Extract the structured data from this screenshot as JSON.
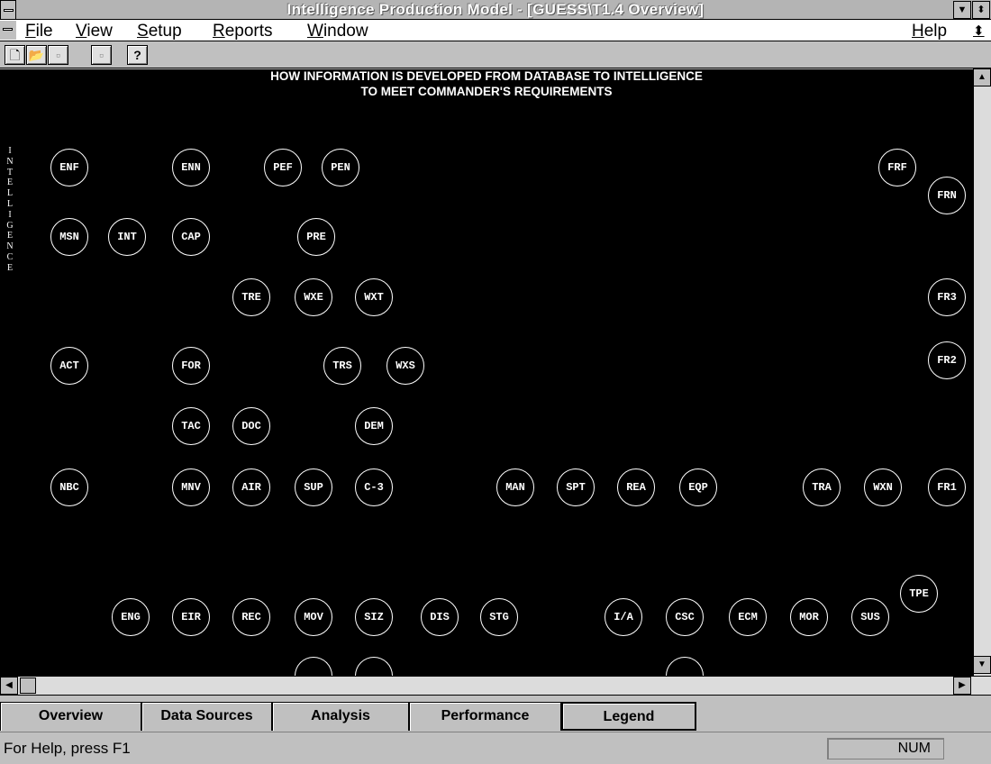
{
  "window": {
    "title": "Intelligence Production Model - [GUESS\\T1.4 Overview]",
    "minimize_glyph": "▼",
    "restore_glyph": "⬍"
  },
  "menu": {
    "items": [
      "File",
      "View",
      "Setup",
      "Reports",
      "Window"
    ],
    "help": "Help",
    "restore_glyph": "⬍"
  },
  "toolbar": {
    "buttons": [
      {
        "icon": "new-document-icon",
        "glyph": "🗋"
      },
      {
        "icon": "open-folder-icon",
        "glyph": "📂"
      },
      {
        "icon": "save-icon",
        "glyph": "▫"
      },
      {
        "icon": "print-icon",
        "glyph": "▫"
      },
      {
        "icon": "help-icon",
        "glyph": "?"
      }
    ]
  },
  "diagram": {
    "heading_line1": "HOW INFORMATION IS DEVELOPED FROM DATABASE TO INTELLIGENCE",
    "heading_line2": "TO MEET COMMANDER'S REQUIREMENTS",
    "vertical_label": "INTELLIGENCE",
    "nodes": [
      "ENF",
      "ENN",
      "PEF",
      "PEN",
      "FRF",
      "FRN",
      "MSN",
      "INT",
      "CAP",
      "PRE",
      "TRE",
      "WXE",
      "WXT",
      "FR3",
      "ACT",
      "FOR",
      "TRS",
      "WXS",
      "FR2",
      "TAC",
      "DOC",
      "DEM",
      "NBC",
      "MNV",
      "AIR",
      "SUP",
      "C-3",
      "MAN",
      "SPT",
      "REA",
      "EQP",
      "TRA",
      "WXN",
      "FR1",
      "TPE",
      "ENG",
      "EIR",
      "REC",
      "MOV",
      "SIZ",
      "DIS",
      "STG",
      "I/A",
      "CSC",
      "ECM",
      "MOR",
      "SUS"
    ]
  },
  "tabs": [
    "Overview",
    "Data Sources",
    "Analysis",
    "Performance",
    "Legend"
  ],
  "status": {
    "help_text": "For Help, press F1",
    "num": "NUM"
  }
}
